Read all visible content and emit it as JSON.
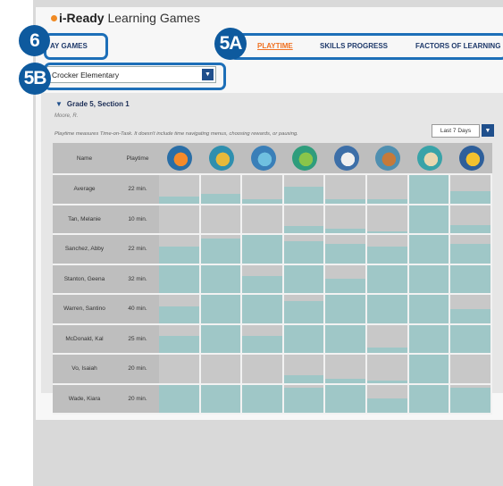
{
  "header": {
    "brand": "i-Ready",
    "product": "Learning Games"
  },
  "nav": {
    "play_games": "AY GAMES",
    "playtime": "PLAYTIME",
    "skills_progress": "SKILLS PROGRESS",
    "factors_of_learning": "FACTORS OF LEARNING"
  },
  "annotations": {
    "badge_6": "6",
    "badge_5a": "5A",
    "badge_5b": "5B"
  },
  "school_select": {
    "value": "Crocker Elementary"
  },
  "section": {
    "title": "Grade 5, Section 1",
    "teacher": "Moore, R.",
    "note": "Playtime measures Time-on-Task. It doesn't include time navigating menus, choosing rewards, or pausing."
  },
  "range_select": {
    "value": "Last 7 Days"
  },
  "table": {
    "col_name": "Name",
    "col_playtime": "Playtime",
    "games": [
      "fish-game-icon",
      "planet-game-icon",
      "book-game-icon",
      "dinosaur-game-icon",
      "astronaut-game-icon",
      "chef-game-icon",
      "cupcake-game-icon",
      "robot-game-icon"
    ],
    "rows": [
      {
        "name": "Average",
        "time": "22 min.",
        "levels": [
          0.25,
          0.35,
          0.15,
          0.6,
          0.15,
          0.15,
          1.0,
          0.45
        ]
      },
      {
        "name": "Tan, Melanie",
        "time": "10 min.",
        "levels": [
          0,
          0,
          0,
          0.25,
          0.15,
          0.05,
          1.0,
          0.3
        ]
      },
      {
        "name": "Sanchez, Abby",
        "time": "22 min.",
        "levels": [
          0.6,
          0.9,
          1.0,
          0.8,
          0.7,
          0.6,
          1.0,
          0.7
        ]
      },
      {
        "name": "Stanton, Geena",
        "time": "32 min.",
        "levels": [
          1.0,
          1.0,
          0.6,
          1.0,
          0.5,
          1.0,
          1.0,
          1.0
        ]
      },
      {
        "name": "Warren, Santino",
        "time": "40 min.",
        "levels": [
          0.6,
          1.0,
          1.0,
          0.8,
          1.0,
          1.0,
          1.0,
          0.5
        ]
      },
      {
        "name": "McDonald, Kal",
        "time": "25 min.",
        "levels": [
          0.6,
          1.0,
          0.6,
          1.0,
          1.0,
          0.2,
          1.0,
          1.0
        ]
      },
      {
        "name": "Vo, Isaiah",
        "time": "20 min.",
        "levels": [
          0,
          0,
          0,
          0.3,
          0.15,
          0.1,
          1.0,
          0
        ]
      },
      {
        "name": "Wade, Kiara",
        "time": "20 min.",
        "levels": [
          1.0,
          1.0,
          1.0,
          0.9,
          1.0,
          0.5,
          1.0,
          0.9
        ]
      }
    ]
  },
  "colors": {
    "cell_bg": "#c8c8c8",
    "bar": "#9fc7c7",
    "header_bg": "#bebebe",
    "accent": "#f07020",
    "nav": "#1f3a6b",
    "annotation": "#0e5a9e"
  }
}
